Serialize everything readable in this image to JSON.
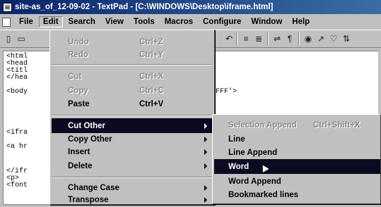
{
  "window": {
    "title": "site-as_of_12-09-02 - TextPad - [C:\\WINDOWS\\Desktop\\iframe.html]"
  },
  "menubar": {
    "items": [
      "File",
      "Edit",
      "Search",
      "View",
      "Tools",
      "Macros",
      "Configure",
      "Window",
      "Help"
    ]
  },
  "editor": {
    "lines": [
      "<html",
      "<head",
      "<titl",
      "</hea",
      "<body",
      "FFF'>",
      "<ifra",
      "<a hr",
      "</ifr",
      "<p>",
      "<font"
    ]
  },
  "edit_menu": {
    "items": [
      {
        "label": "Undo",
        "shortcut": "Ctrl+Z",
        "state": "disabled"
      },
      {
        "label": "Redo",
        "shortcut": "Ctrl+Y",
        "state": "disabled"
      },
      {
        "label": "Cut",
        "shortcut": "Ctrl+X",
        "state": "disabled"
      },
      {
        "label": "Copy",
        "shortcut": "Ctrl+C",
        "state": "disabled"
      },
      {
        "label": "Paste",
        "shortcut": "Ctrl+V",
        "state": "enabled"
      },
      {
        "label": "Cut Other",
        "shortcut": "",
        "state": "selected"
      },
      {
        "label": "Copy Other",
        "shortcut": "",
        "state": "enabled"
      },
      {
        "label": "Insert",
        "shortcut": "",
        "state": "enabled"
      },
      {
        "label": "Delete",
        "shortcut": "",
        "state": "enabled"
      },
      {
        "label": "Change Case",
        "shortcut": "",
        "state": "enabled"
      },
      {
        "label": "Transpose",
        "shortcut": "",
        "state": "enabled"
      }
    ]
  },
  "cut_other_submenu": {
    "items": [
      {
        "label": "Selection Append",
        "shortcut": "Ctrl+Shift+X",
        "state": "disabled"
      },
      {
        "label": "Line",
        "shortcut": "",
        "state": "enabled"
      },
      {
        "label": "Line Append",
        "shortcut": "",
        "state": "enabled"
      },
      {
        "label": "Word",
        "shortcut": "",
        "state": "selected"
      },
      {
        "label": "Word Append",
        "shortcut": "",
        "state": "enabled"
      },
      {
        "label": "Bookmarked lines",
        "shortcut": "",
        "state": "enabled"
      }
    ]
  },
  "colors": {
    "titlebar": "#0a246a",
    "menu_face": "#c0c0c0",
    "highlight": "#0a0a20",
    "disabled_text": "#8a8a8a"
  }
}
